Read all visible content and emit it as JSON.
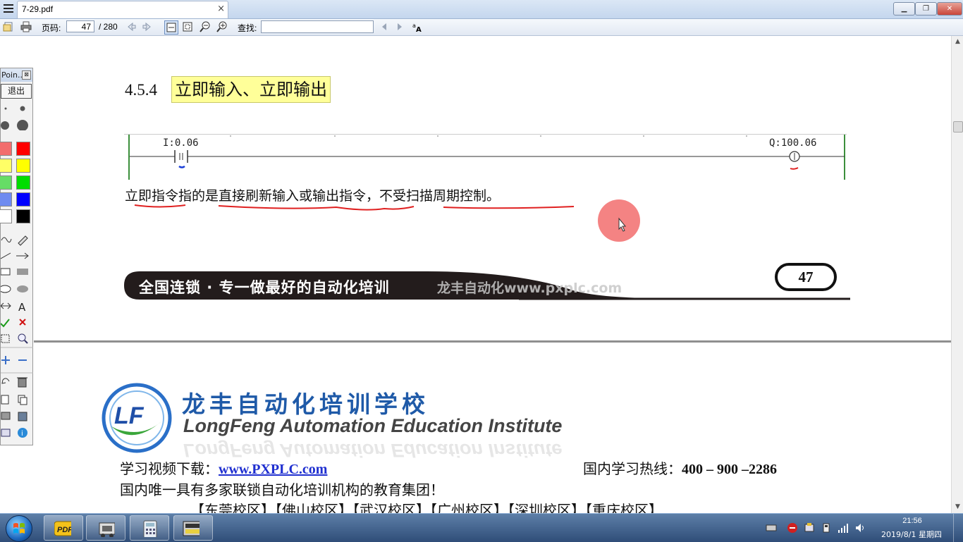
{
  "titlebar": {
    "tab_title": "7-29.pdf",
    "tab_close": "×",
    "minimize": "▁",
    "maximize": "❐",
    "close": "✕"
  },
  "toolbar": {
    "page_label": "页码:",
    "page_current": "47",
    "page_total": "/ 280",
    "find_label": "查找:",
    "search_value": ""
  },
  "document": {
    "section_number": "4.5.4",
    "section_title": "立即输入、立即输出",
    "ladder": {
      "input_label": "I:0.06",
      "output_label": "Q:100.06"
    },
    "description": "立即指令指的是直接刷新输入或输出指令，不受扫描周期控制。",
    "footer_slogan": "全国连锁 · 专一做最好的自动化培训",
    "footer_watermark": "龙丰自动化www.pxplc.com",
    "page_number": "47",
    "brand_cn": "龙丰自动化培训学校",
    "brand_en": "LongFeng Automation  Education Institute",
    "logo_text": "LF",
    "download_label": "学习视频下载：",
    "download_link": "www.PXPLC.com",
    "hotline_label": "国内学习热线：",
    "hotline_number": "400 – 900 –2286",
    "group_text": "国内唯一具有多家联锁自动化培训机构的教育集团！",
    "campuses": "【东莞校区】【佛山校区】【武汉校区】【广州校区】【深圳校区】【重庆校区】"
  },
  "palette": {
    "title": "Poin...",
    "title_close": "⊠",
    "exit": "退出",
    "text_tool": "A",
    "colors": [
      "#f26d6d",
      "#ff0000",
      "#ffff66",
      "#ffff00",
      "#66dd66",
      "#00dd00",
      "#6e8bf0",
      "#0000ff",
      "#ffffff",
      "#000000"
    ]
  },
  "taskbar": {
    "time": "21:56",
    "date": "2019/8/1 星期四",
    "pdf_label": "PDF"
  }
}
